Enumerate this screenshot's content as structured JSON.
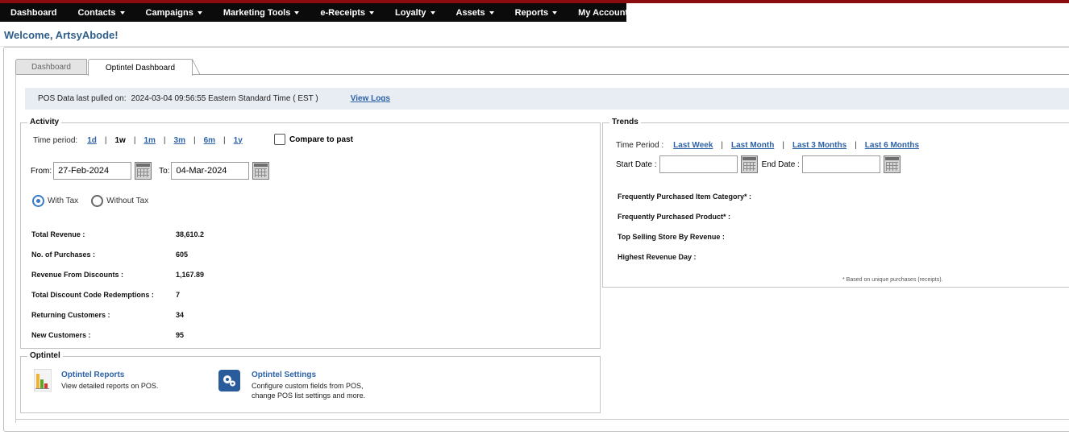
{
  "nav": {
    "items": [
      {
        "label": "Dashboard",
        "dropdown": false
      },
      {
        "label": "Contacts",
        "dropdown": true
      },
      {
        "label": "Campaigns",
        "dropdown": true
      },
      {
        "label": "Marketing Tools",
        "dropdown": true
      },
      {
        "label": "e-Receipts",
        "dropdown": true
      },
      {
        "label": "Loyalty",
        "dropdown": true
      },
      {
        "label": "Assets",
        "dropdown": true
      },
      {
        "label": "Reports",
        "dropdown": true
      },
      {
        "label": "My Account",
        "dropdown": true
      }
    ],
    "accent_color": "#8b0c10",
    "bar_color": "#0b0b0b"
  },
  "welcome": "Welcome, ArtsyAbode!",
  "tabs": [
    {
      "label": "Dashboard",
      "active": false
    },
    {
      "label": "Optintel Dashboard",
      "active": true
    }
  ],
  "pos": {
    "label": "POS Data last pulled on:",
    "value": "2024-03-04 09:56:55 Eastern Standard Time ( EST )",
    "view_logs": "View Logs"
  },
  "activity": {
    "legend": "Activity",
    "time_period_label": "Time period:",
    "periods": [
      "1d",
      "1w",
      "1m",
      "3m",
      "6m",
      "1y"
    ],
    "current_period": "1w",
    "compare_label": "Compare to past",
    "compare_checked": false,
    "from_label": "From:",
    "from_value": "27-Feb-2024",
    "to_label": "To:",
    "to_value": "04-Mar-2024",
    "tax_options": [
      {
        "label": "With Tax",
        "selected": true
      },
      {
        "label": "Without Tax",
        "selected": false
      }
    ],
    "stats": [
      {
        "label": "Total Revenue :",
        "value": "38,610.2"
      },
      {
        "label": "No. of Purchases :",
        "value": "605"
      },
      {
        "label": "Revenue From Discounts :",
        "value": "1,167.89"
      },
      {
        "label": "Total Discount Code Redemptions :",
        "value": "7"
      },
      {
        "label": "Returning Customers :",
        "value": "34"
      },
      {
        "label": "New Customers :",
        "value": "95"
      }
    ]
  },
  "trends": {
    "legend": "Trends",
    "time_period_label": "Time Period :",
    "periods": [
      "Last Week",
      "Last Month",
      "Last 3 Months",
      "Last 6 Months"
    ],
    "start_label": "Start Date :",
    "start_value": "",
    "end_label": "End Date :",
    "end_value": "",
    "questions": [
      "Frequently Purchased Item Category* :",
      "Frequently Purchased Product* :",
      "Top Selling Store By Revenue :",
      "Highest Revenue Day :"
    ],
    "note": "* Based on unique purchases (receipts)."
  },
  "optintel": {
    "legend": "Optintel",
    "reports": {
      "title": "Optintel Reports",
      "desc": "View detailed reports on POS."
    },
    "settings": {
      "title": "Optintel Settings",
      "desc_line1": "Configure custom fields from POS,",
      "desc_line2": "change POS list settings and more."
    }
  }
}
